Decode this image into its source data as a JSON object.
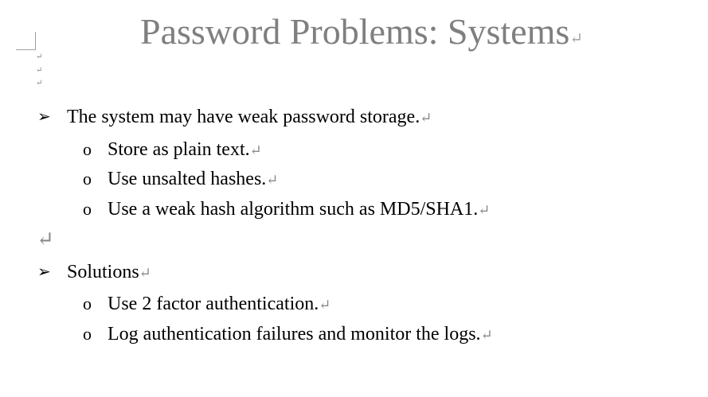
{
  "heading": {
    "title": "Password Problems: Systems",
    "mark": "↵"
  },
  "paragraph_mark": "↵",
  "section_1": {
    "bullet": "➢",
    "text": "The system may have weak password storage.",
    "sub_bullet": "o",
    "items": [
      "Store as plain text.",
      "Use unsalted hashes.",
      "Use a weak hash algorithm such as MD5/SHA1."
    ]
  },
  "section_2": {
    "bullet": "➢",
    "text": "Solutions",
    "sub_bullet": "o",
    "items": [
      "Use 2 factor authentication.",
      "Log authentication failures and monitor the logs."
    ]
  }
}
